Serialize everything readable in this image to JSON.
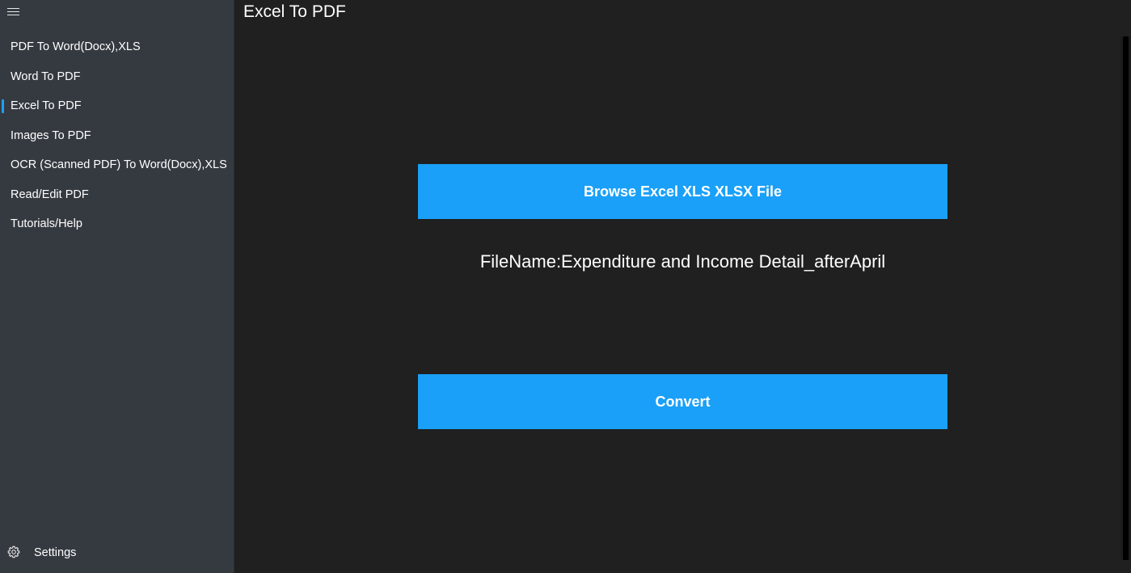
{
  "sidebar": {
    "menu_icon": "hamburger-menu-icon",
    "items": [
      {
        "label": "PDF To Word(Docx),XLS"
      },
      {
        "label": "Word To PDF"
      },
      {
        "label": "Excel To PDF"
      },
      {
        "label": "Images To PDF"
      },
      {
        "label": "OCR (Scanned PDF) To Word(Docx),XLS"
      },
      {
        "label": "Read/Edit PDF"
      },
      {
        "label": "Tutorials/Help"
      }
    ],
    "active_index": 2,
    "settings": {
      "icon": "gear-icon",
      "label": "Settings"
    }
  },
  "main": {
    "title": "Excel To PDF",
    "browse_button": "Browse Excel XLS XLSX File",
    "filename_text": "FileName:Expenditure and Income Detail_afterApril",
    "convert_button": "Convert"
  },
  "colors": {
    "accent": "#1aa0f8",
    "sidebar_bg": "#353a41",
    "main_bg": "#202020",
    "text": "#ffffff"
  }
}
